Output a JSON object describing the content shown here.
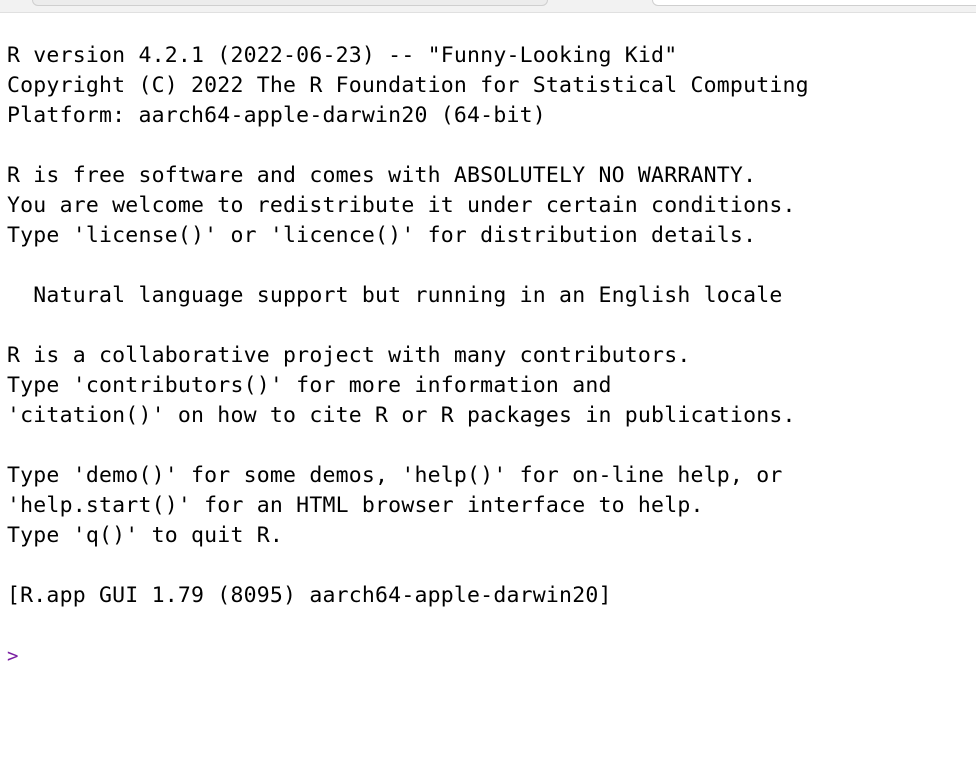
{
  "console": {
    "lines": [
      "R version 4.2.1 (2022-06-23) -- \"Funny-Looking Kid\"",
      "Copyright (C) 2022 The R Foundation for Statistical Computing",
      "Platform: aarch64-apple-darwin20 (64-bit)",
      "",
      "R is free software and comes with ABSOLUTELY NO WARRANTY.",
      "You are welcome to redistribute it under certain conditions.",
      "Type 'license()' or 'licence()' for distribution details.",
      "",
      "  Natural language support but running in an English locale",
      "",
      "R is a collaborative project with many contributors.",
      "Type 'contributors()' for more information and",
      "'citation()' on how to cite R or R packages in publications.",
      "",
      "Type 'demo()' for some demos, 'help()' for on-line help, or",
      "'help.start()' for an HTML browser interface to help.",
      "Type 'q()' to quit R.",
      "",
      "[R.app GUI 1.79 (8095) aarch64-apple-darwin20]"
    ],
    "prompt": ">"
  }
}
